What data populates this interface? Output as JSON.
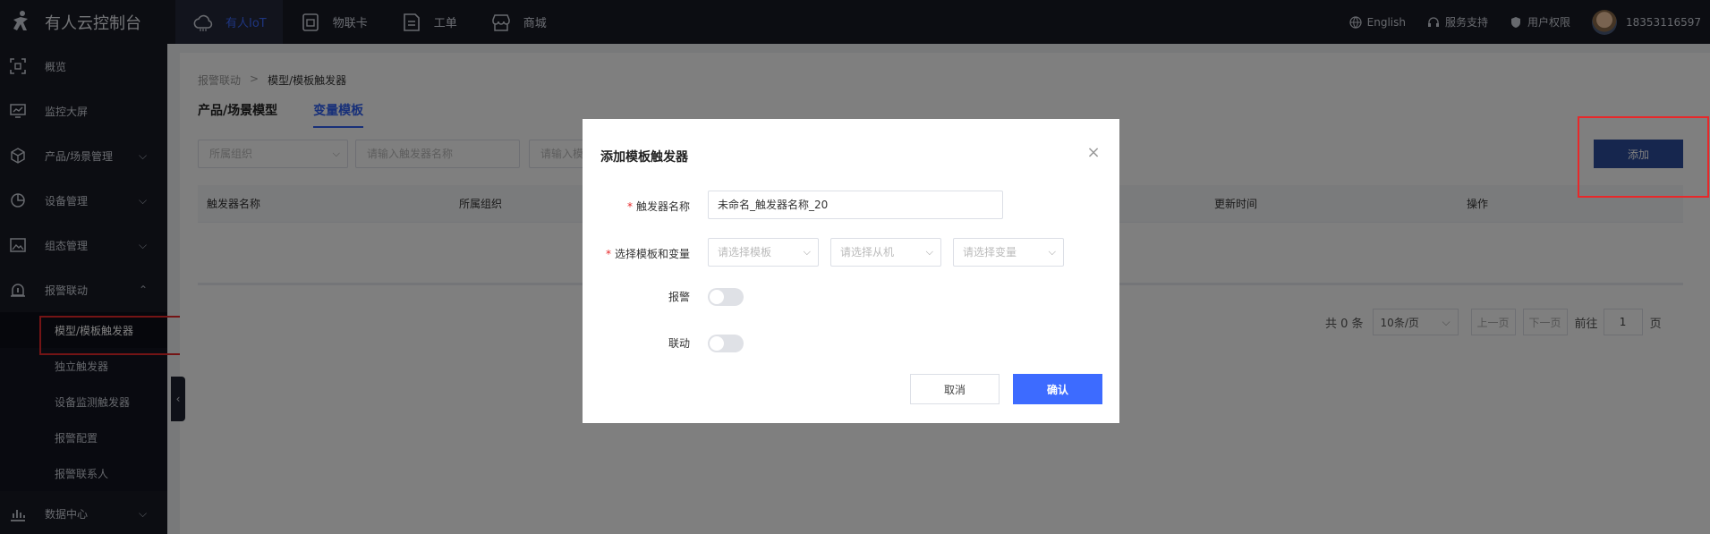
{
  "brand": {
    "title": "有人云控制台"
  },
  "nav": [
    {
      "label": "有人IoT",
      "icon": "cloud-icon"
    },
    {
      "label": "物联卡",
      "icon": "sim-card-icon"
    },
    {
      "label": "工单",
      "icon": "ticket-icon"
    },
    {
      "label": "商城",
      "icon": "store-icon"
    }
  ],
  "topright": {
    "language": "English",
    "support": "服务支持",
    "permissions": "用户权限",
    "account": "18353116597"
  },
  "sidebar": {
    "items": [
      {
        "label": "概览",
        "icon": "overview-icon"
      },
      {
        "label": "监控大屏",
        "icon": "monitor-icon"
      },
      {
        "label": "产品/场景管理",
        "icon": "cube-icon",
        "chevron": "down"
      },
      {
        "label": "设备管理",
        "icon": "pie-icon",
        "chevron": "down"
      },
      {
        "label": "组态管理",
        "icon": "image-icon",
        "chevron": "down"
      },
      {
        "label": "报警联动",
        "icon": "alarm-icon",
        "chevron": "up"
      }
    ],
    "subitems": [
      {
        "label": "模型/模板触发器"
      },
      {
        "label": "独立触发器"
      },
      {
        "label": "设备监测触发器"
      },
      {
        "label": "报警配置"
      },
      {
        "label": "报警联系人"
      }
    ],
    "last": {
      "label": "数据中心",
      "icon": "chart-icon",
      "chevron": "down"
    }
  },
  "breadcrumb": {
    "parent": "报警联动",
    "separator": ">",
    "current": "模型/模板触发器"
  },
  "tabs": [
    {
      "label": "产品/场景模型"
    },
    {
      "label": "变量模板"
    }
  ],
  "filters": {
    "org_placeholder": "所属组织",
    "name_placeholder": "请输入触发器名称",
    "tpl_placeholder": "请输入模"
  },
  "add_button": "添加",
  "table": {
    "columns": [
      "触发器名称",
      "所属组织",
      "更新时间",
      "操作"
    ]
  },
  "pagination": {
    "total": "共 0 条",
    "page_size": "10条/页",
    "prev": "上一页",
    "next": "下一页",
    "goto_prefix": "前往",
    "goto_value": "1",
    "goto_suffix": "页"
  },
  "modal": {
    "title": "添加模板触发器",
    "trigger_name_label": "触发器名称",
    "trigger_name_value": "未命名_触发器名称_20",
    "select_label": "选择模板和变量",
    "template_placeholder": "请选择模板",
    "slave_placeholder": "请选择从机",
    "variable_placeholder": "请选择变量",
    "alarm_label": "报警",
    "alarm_on": false,
    "linkage_label": "联动",
    "linkage_on": false,
    "cancel": "取消",
    "confirm": "确认"
  },
  "colors": {
    "accent": "#3d6bff",
    "topbar": "#181a24",
    "highlight": "#e8282a"
  }
}
